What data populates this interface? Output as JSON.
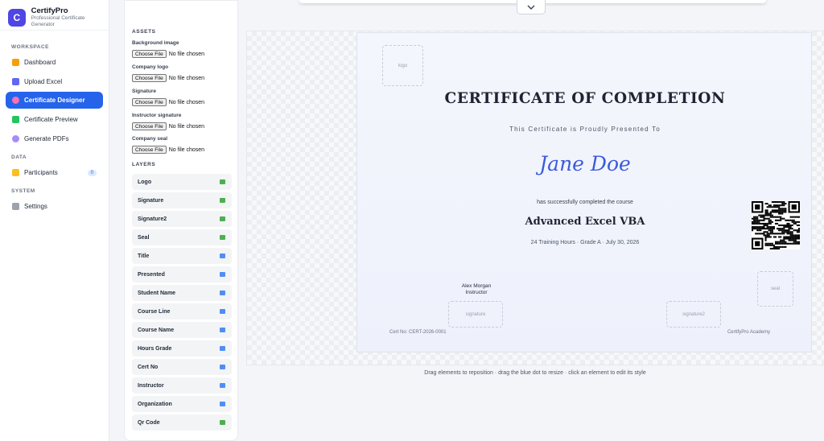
{
  "app": {
    "name": "CertifyPro",
    "subtitle": "Professional Certificate Generator",
    "logo_letter": "C"
  },
  "sidebar": {
    "sections": [
      {
        "label": "WORKSPACE"
      },
      {
        "label": "DATA"
      },
      {
        "label": "SYSTEM"
      }
    ],
    "items": [
      {
        "label": "Dashboard",
        "icon": "bar-chart-icon",
        "color": "#f59e0b"
      },
      {
        "label": "Upload Excel",
        "icon": "upload-icon",
        "color": "#6366f1"
      },
      {
        "label": "Certificate Designer",
        "icon": "palette-icon",
        "color": "#f472b6",
        "active": true
      },
      {
        "label": "Certificate Preview",
        "icon": "image-icon",
        "color": "#22c55e"
      },
      {
        "label": "Generate PDFs",
        "icon": "gear-icon",
        "color": "#a78bfa"
      },
      {
        "label": "Participants",
        "icon": "folder-icon",
        "color": "#fbbf24",
        "badge": "0"
      },
      {
        "label": "Settings",
        "icon": "tools-icon",
        "color": "#9ca3af"
      }
    ]
  },
  "assets": {
    "heading": "ASSETS",
    "choose_label": "Choose File",
    "no_file": "No file chosen",
    "fields": [
      "Background image",
      "Company logo",
      "Signature",
      "Instructor signature",
      "Company seal"
    ]
  },
  "layers": {
    "heading": "LAYERS",
    "items": [
      {
        "label": "Logo",
        "kind": "image"
      },
      {
        "label": "Signature",
        "kind": "image"
      },
      {
        "label": "Signature2",
        "kind": "image"
      },
      {
        "label": "Seal",
        "kind": "image"
      },
      {
        "label": "Title",
        "kind": "text"
      },
      {
        "label": "Presented",
        "kind": "text"
      },
      {
        "label": "Student Name",
        "kind": "text"
      },
      {
        "label": "Course Line",
        "kind": "text"
      },
      {
        "label": "Course Name",
        "kind": "text"
      },
      {
        "label": "Hours Grade",
        "kind": "text"
      },
      {
        "label": "Cert No",
        "kind": "text"
      },
      {
        "label": "Instructor",
        "kind": "text"
      },
      {
        "label": "Organization",
        "kind": "text"
      },
      {
        "label": "Qr Code",
        "kind": "image"
      }
    ],
    "image_color": "#4caf50",
    "text_color": "#4f8ef7"
  },
  "certificate": {
    "logo_placeholder": "logo",
    "title": "CERTIFICATE OF COMPLETION",
    "presented": "This Certificate is Proudly Presented To",
    "student_name": "Jane Doe",
    "course_line": "has successfully completed the course",
    "course_name": "Advanced Excel VBA",
    "hours_grade": "24 Training Hours · Grade A · July 30, 2026",
    "instructor_name": "Alex Morgan",
    "instructor_role": "Instructor",
    "signature_placeholder": "signature",
    "signature2_placeholder": "signature2",
    "seal_placeholder": "seal",
    "cert_no": "Cert No: CERT-2026-0001",
    "organization": "CertifyPro Academy"
  },
  "canvas": {
    "hint": "Drag elements to reposition · drag the blue dot to resize · click an element to edit its style",
    "collapse_icon": "chevron-down-icon"
  }
}
